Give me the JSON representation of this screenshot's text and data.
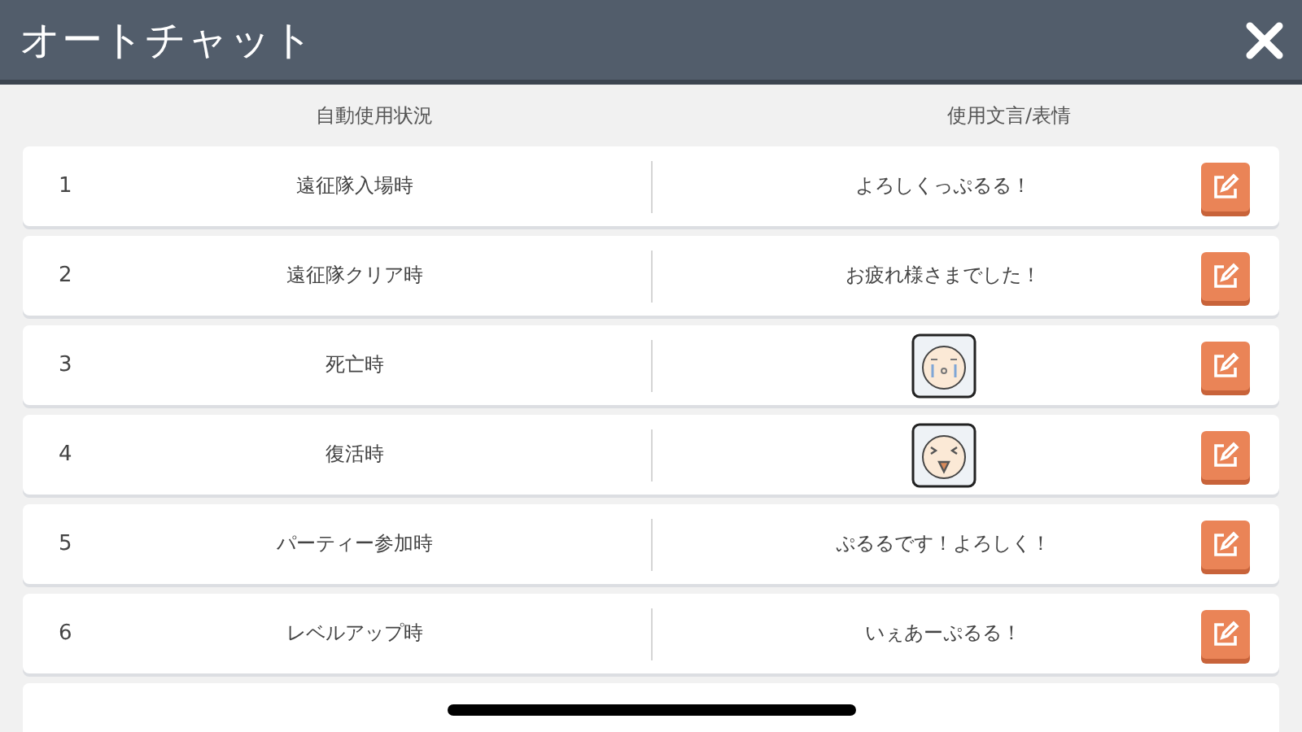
{
  "window": {
    "title": "オートチャット"
  },
  "columns": [
    "自動使用状況",
    "使用文言/表情"
  ],
  "rows": [
    {
      "number": "1",
      "situation": "遠征隊入場時",
      "kind": "text",
      "message": "よろしくっぷるる！"
    },
    {
      "number": "2",
      "situation": "遠征隊クリア時",
      "kind": "text",
      "message": "お疲れ様さまでした！"
    },
    {
      "number": "3",
      "situation": "死亡時",
      "kind": "crying"
    },
    {
      "number": "4",
      "situation": "復活時",
      "kind": "laughing"
    },
    {
      "number": "5",
      "situation": "パーティー参加時",
      "kind": "text",
      "message": "ぷるるです！よろしく！"
    },
    {
      "number": "6",
      "situation": "レベルアップ時",
      "kind": "text",
      "message": "いぇあーぷるる！"
    }
  ]
}
